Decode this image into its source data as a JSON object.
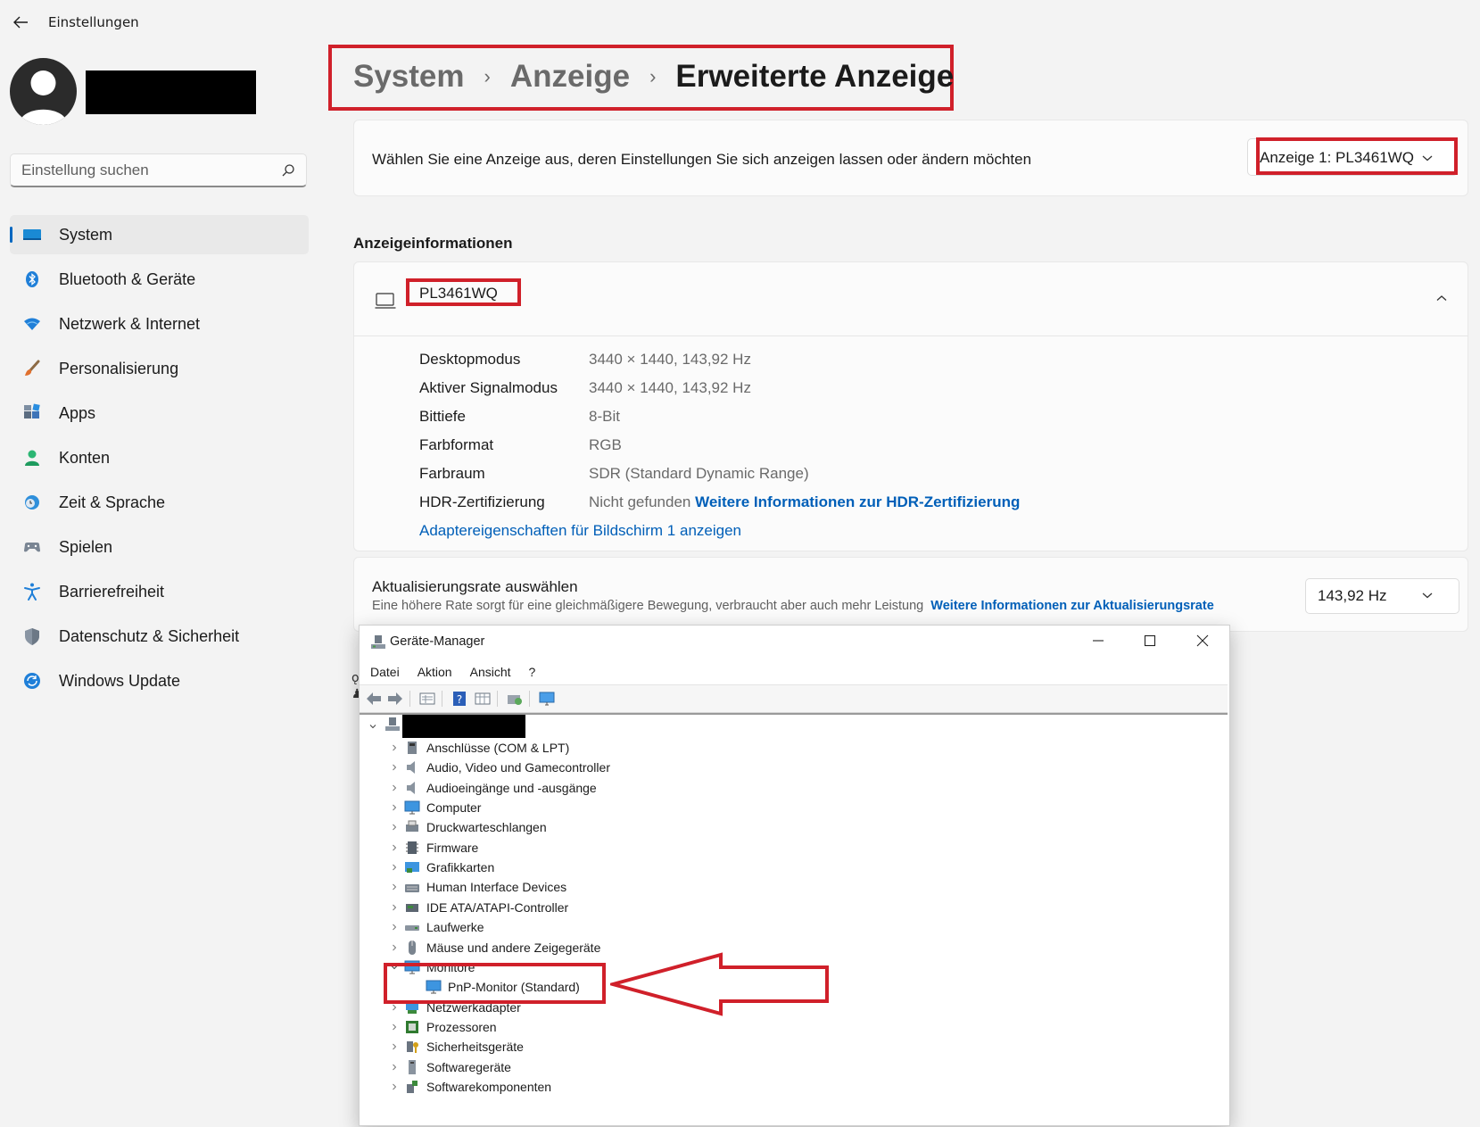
{
  "window": {
    "title": "Einstellungen"
  },
  "search": {
    "placeholder": "Einstellung suchen"
  },
  "sidebar": {
    "items": [
      {
        "label": "System",
        "icon": "display-icon",
        "active": true
      },
      {
        "label": "Bluetooth & Geräte",
        "icon": "bluetooth-icon"
      },
      {
        "label": "Netzwerk & Internet",
        "icon": "wifi-icon"
      },
      {
        "label": "Personalisierung",
        "icon": "brush-icon"
      },
      {
        "label": "Apps",
        "icon": "apps-icon"
      },
      {
        "label": "Konten",
        "icon": "account-icon"
      },
      {
        "label": "Zeit & Sprache",
        "icon": "clock-globe-icon"
      },
      {
        "label": "Spielen",
        "icon": "gamepad-icon"
      },
      {
        "label": "Barrierefreiheit",
        "icon": "accessibility-icon"
      },
      {
        "label": "Datenschutz & Sicherheit",
        "icon": "shield-icon"
      },
      {
        "label": "Windows Update",
        "icon": "update-icon"
      }
    ]
  },
  "breadcrumb": {
    "items": [
      "System",
      "Anzeige",
      "Erweiterte Anzeige"
    ],
    "separator": "›"
  },
  "display_select": {
    "prompt": "Wählen Sie eine Anzeige aus, deren Einstellungen Sie sich anzeigen lassen oder ändern möchten",
    "value": "Anzeige 1: PL3461WQ"
  },
  "display_info": {
    "section_title": "Anzeigeinformationen",
    "monitor_name": "PL3461WQ",
    "rows": [
      {
        "label": "Desktopmodus",
        "value": "3440 × 1440, 143,92 Hz"
      },
      {
        "label": "Aktiver Signalmodus",
        "value": "3440 × 1440, 143,92 Hz"
      },
      {
        "label": "Bittiefe",
        "value": "8-Bit"
      },
      {
        "label": "Farbformat",
        "value": "RGB"
      },
      {
        "label": "Farbraum",
        "value": "SDR (Standard Dynamic Range)"
      },
      {
        "label": "HDR-Zertifizierung",
        "value": "Nicht gefunden",
        "link": "Weitere Informationen zur HDR-Zertifizierung"
      }
    ],
    "adapter_link": "Adaptereigenschaften für Bildschirm 1 anzeigen"
  },
  "refresh_rate": {
    "title": "Aktualisierungsrate auswählen",
    "description": "Eine höhere Rate sorgt für eine gleichmäßigere Bewegung, verbraucht aber auch mehr Leistung",
    "link": "Weitere Informationen zur Aktualisierungsrate",
    "value": "143,92 Hz"
  },
  "device_manager": {
    "title": "Geräte-Manager",
    "menu": [
      "Datei",
      "Aktion",
      "Ansicht",
      "?"
    ],
    "tree": [
      {
        "label": "Anschlüsse (COM & LPT)",
        "icon": "port-icon"
      },
      {
        "label": "Audio, Video und Gamecontroller",
        "icon": "speaker-icon"
      },
      {
        "label": "Audioeingänge und -ausgänge",
        "icon": "speaker-icon"
      },
      {
        "label": "Computer",
        "icon": "computer-icon"
      },
      {
        "label": "Druckwarteschlangen",
        "icon": "printer-icon"
      },
      {
        "label": "Firmware",
        "icon": "chip-icon"
      },
      {
        "label": "Grafikkarten",
        "icon": "graphics-card-icon"
      },
      {
        "label": "Human Interface Devices",
        "icon": "hid-icon"
      },
      {
        "label": "IDE ATA/ATAPI-Controller",
        "icon": "ide-controller-icon"
      },
      {
        "label": "Laufwerke",
        "icon": "drive-icon"
      },
      {
        "label": "Mäuse und andere Zeigegeräte",
        "icon": "mouse-icon"
      },
      {
        "label": "Monitore",
        "icon": "monitor-icon",
        "expanded": true
      },
      {
        "label": "PnP-Monitor (Standard)",
        "icon": "monitor-icon",
        "child": true
      },
      {
        "label": "Netzwerkadapter",
        "icon": "network-adapter-icon"
      },
      {
        "label": "Prozessoren",
        "icon": "processor-icon"
      },
      {
        "label": "Sicherheitsgeräte",
        "icon": "security-device-icon"
      },
      {
        "label": "Softwaregeräte",
        "icon": "software-device-icon"
      },
      {
        "label": "Softwarekomponenten",
        "icon": "software-component-icon"
      }
    ]
  },
  "colors": {
    "accent": "#0067c0",
    "link": "#005fb8",
    "highlight_red": "#d0202a"
  }
}
